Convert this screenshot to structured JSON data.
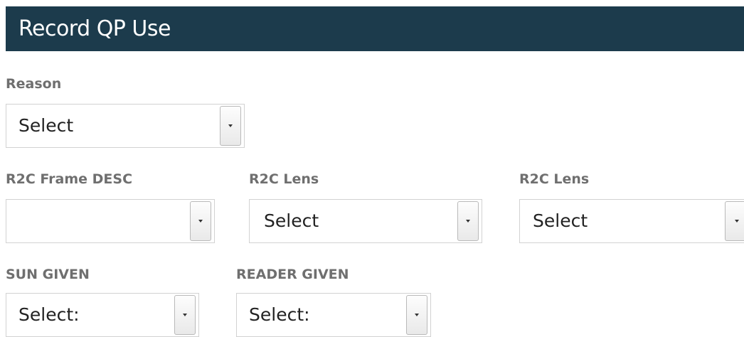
{
  "header": {
    "title": "Record QP Use"
  },
  "form": {
    "reason": {
      "label": "Reason",
      "value": "Select"
    },
    "r2c_frame_desc": {
      "label": "R2C Frame DESC",
      "value": ""
    },
    "r2c_lens_1": {
      "label": "R2C Lens",
      "value": "Select"
    },
    "r2c_lens_2": {
      "label": "R2C Lens",
      "value": "Select"
    },
    "sun_given": {
      "label": "SUN GIVEN",
      "value": "Select:"
    },
    "reader_given": {
      "label": "READER GIVEN",
      "value": "Select:"
    }
  }
}
